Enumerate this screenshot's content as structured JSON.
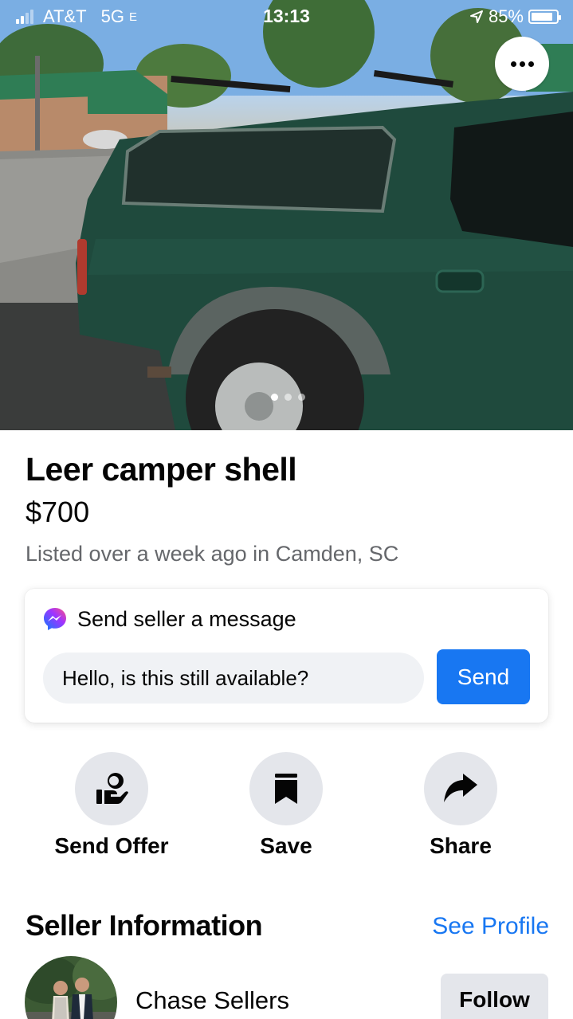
{
  "status_bar": {
    "carrier": "AT&T",
    "network": "5G",
    "network_suffix": "E",
    "time": "13:13",
    "battery_percent": "85%",
    "battery_level": 0.85
  },
  "photo": {
    "page_index": 0,
    "page_count": 3,
    "more_icon": "more-horizontal-icon"
  },
  "listing": {
    "title": "Leer camper shell",
    "price": "$700",
    "meta": "Listed over a week ago in Camden, SC"
  },
  "message_card": {
    "heading": "Send seller a message",
    "icon": "messenger-icon",
    "input_value": "Hello, is this still available?",
    "send_label": "Send"
  },
  "actions": [
    {
      "label": "Send Offer",
      "icon": "offer-hand-icon"
    },
    {
      "label": "Save",
      "icon": "bookmark-icon"
    },
    {
      "label": "Share",
      "icon": "share-arrow-icon"
    }
  ],
  "seller": {
    "section_title": "Seller Information",
    "see_profile_label": "See Profile",
    "name": "Chase Sellers",
    "follow_label": "Follow"
  },
  "colors": {
    "accent": "#1877f2",
    "secondary_text": "#65676b",
    "button_gray": "#e4e6eb",
    "truck_green": "#1f4a3d"
  }
}
